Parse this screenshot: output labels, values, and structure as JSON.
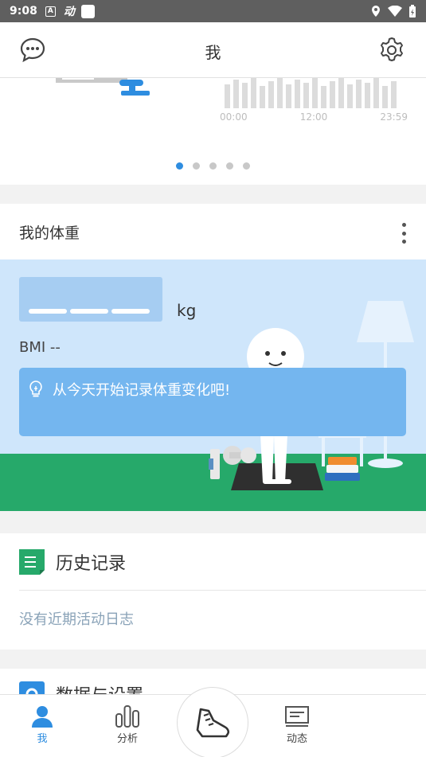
{
  "status_bar": {
    "time": "9:08",
    "notif_icons": [
      "A",
      "动"
    ]
  },
  "header": {
    "title": "我",
    "left_icon": "chat-bubble-icon",
    "right_icon": "gear-icon"
  },
  "carousel": {
    "chart_times": [
      "00:00",
      "12:00",
      "23:59"
    ],
    "page_count": 5,
    "active_page": 0
  },
  "weight": {
    "title": "我的体重",
    "unit": "kg",
    "bmi": "BMI --",
    "tip": "从今天开始记录体重变化吧!"
  },
  "history": {
    "title": "历史记录",
    "empty_text": "没有近期活动日志"
  },
  "data_settings": {
    "title": "数据与设置"
  },
  "bottom_nav": {
    "items": [
      {
        "label": "我",
        "icon": "person-icon",
        "active": true
      },
      {
        "label": "分析",
        "icon": "bar-chart-icon",
        "active": false
      },
      {
        "label": "",
        "icon": "shoe-icon",
        "active": false
      },
      {
        "label": "动态",
        "icon": "feed-icon",
        "active": false
      }
    ]
  },
  "colors": {
    "accent": "#2e8de0",
    "floor": "#26a96a",
    "scene_bg": "#cfe6fb",
    "tip_bg": "#74b6ef"
  }
}
